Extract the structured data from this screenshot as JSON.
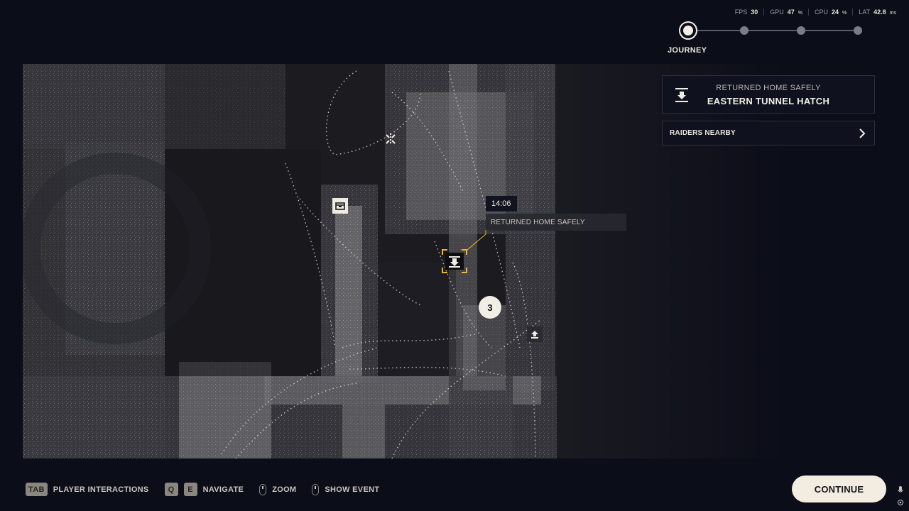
{
  "stats": [
    {
      "label": "FPS",
      "value": "30",
      "unit": ""
    },
    {
      "label": "GPU",
      "value": "47",
      "unit": "%"
    },
    {
      "label": "CPU",
      "value": "24",
      "unit": "%"
    },
    {
      "label": "LAT",
      "value": "42.8",
      "unit": "ms"
    }
  ],
  "journey": {
    "label": "JOURNEY",
    "steps_total": 4,
    "current_step": 1
  },
  "event_card": {
    "icon": "download-tray-icon",
    "subtitle": "RETURNED HOME SAFELY",
    "title": "EASTERN TUNNEL HATCH"
  },
  "raiders": {
    "label": "RAIDERS NEARBY",
    "icon": "chevron-right-icon"
  },
  "map": {
    "tooltip_time": "14:06",
    "tooltip_label": "RETURNED HOME SAFELY",
    "badge": "3",
    "accent": "#f0b429"
  },
  "hints": [
    {
      "keys": [
        "TAB"
      ],
      "label": "PLAYER INTERACTIONS"
    },
    {
      "keys": [
        "Q",
        "E"
      ],
      "label": "NAVIGATE"
    },
    {
      "keys": [],
      "icon": "mouse-scroll-icon",
      "label": "ZOOM"
    },
    {
      "keys": [],
      "icon": "mouse-click-icon",
      "label": "SHOW EVENT"
    }
  ],
  "continue_label": "CONTINUE"
}
